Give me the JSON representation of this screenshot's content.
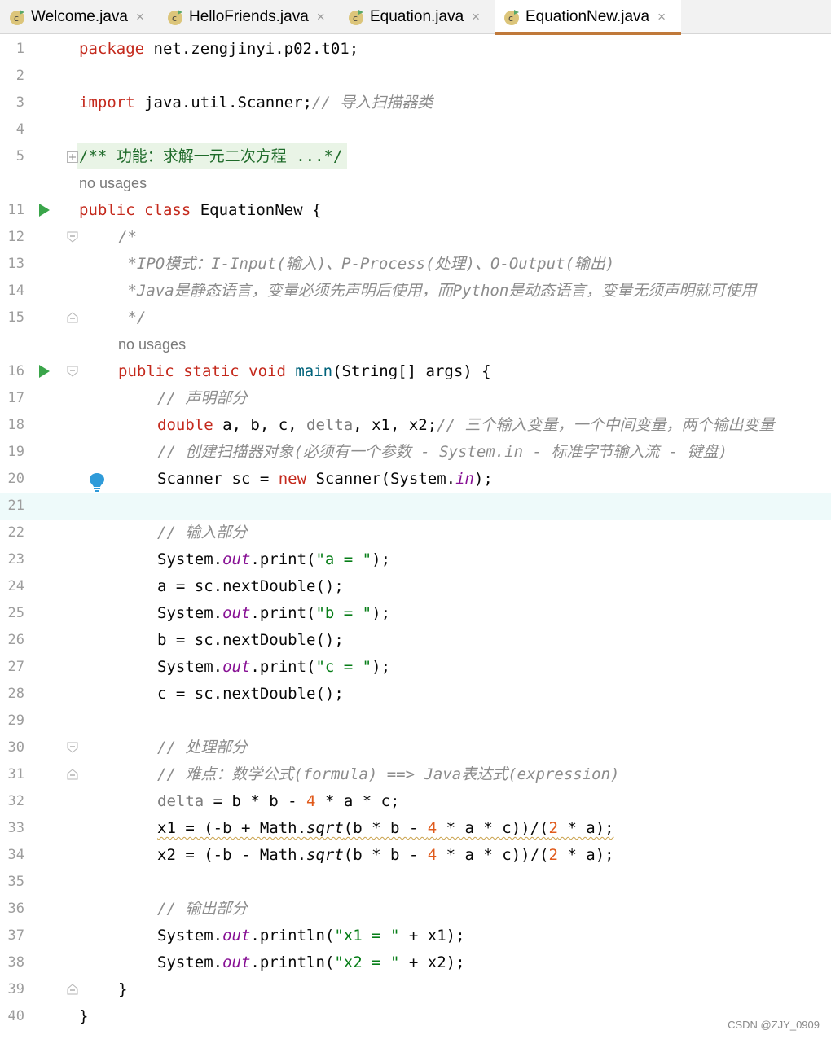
{
  "tabs": [
    {
      "label": "Welcome.java",
      "active": false
    },
    {
      "label": "HelloFriends.java",
      "active": false
    },
    {
      "label": "Equation.java",
      "active": false
    },
    {
      "label": "EquationNew.java",
      "active": true
    }
  ],
  "tab_close_glyph": "×",
  "gutter": {
    "line_numbers": [
      "1",
      "2",
      "3",
      "4",
      "5",
      "11",
      "12",
      "13",
      "14",
      "15",
      "16",
      "17",
      "18",
      "19",
      "20",
      "21",
      "22",
      "23",
      "24",
      "25",
      "26",
      "27",
      "28",
      "29",
      "30",
      "31",
      "32",
      "33",
      "34",
      "35",
      "36",
      "37",
      "38",
      "39",
      "40"
    ],
    "run_markers_on_lines": [
      "11",
      "16"
    ],
    "bulb_on_line": "20",
    "current_line": "21"
  },
  "hints": {
    "class_usages": "no usages",
    "main_usages": "no usages"
  },
  "code": {
    "l1_kw": "package",
    "l1_rest": " net.zengjinyi.p02.t01;",
    "l3_kw": "import",
    "l3_rest": " java.util.Scanner;",
    "l3_comment": "// 导入扫描器类",
    "l5": "/** 功能：求解一元二次方程 ...*/",
    "l11_kw": "public class",
    "l11_rest": " EquationNew {",
    "l12": "/*",
    "l13": " *IPO模式：I-Input(输入)、P-Process(处理)、O-Output(输出)",
    "l14": " *Java是静态语言，变量必须先声明后使用，而Python是动态语言，变量无须声明就可使用",
    "l15": " */",
    "l16_kw": "public static void",
    "l16_fn": " main",
    "l16_rest": "(String[] args) {",
    "l17": "// 声明部分",
    "l18_kw": "double",
    "l18_a": " a, b, c, ",
    "l18_delta": "delta",
    "l18_rest": ", x1, x2;",
    "l18_comment": "// 三个输入变量，一个中间变量，两个输出变量",
    "l19": "// 创建扫描器对象(必须有一个参数 - System.in - 标准字节输入流 - 键盘)",
    "l20_a": "Scanner sc = ",
    "l20_kw": "new",
    "l20_b": " Scanner(System.",
    "l20_in": "in",
    "l20_c": ");",
    "l22": "// 输入部分",
    "sys": "System.",
    "out": "out",
    "print": ".print(",
    "println": ".println(",
    "l23_str": "\"a = \"",
    "l25_str": "\"b = \"",
    "l27_str": "\"c = \"",
    "close": ");",
    "l24": "a = sc.nextDouble();",
    "l26": "b = sc.nextDouble();",
    "l28": "c = sc.nextDouble();",
    "l30": "// 处理部分",
    "l31": "// 难点：数学公式(formula) ==> Java表达式(expression)",
    "l32_delta": "delta",
    "l32_a": " = b * b - ",
    "l32_4": "4",
    "l32_b": " * a * c;",
    "l33_a": "x1 = (-b + Math.",
    "l34_a": "x2 = (-b - Math.",
    "sqrt": "sqrt",
    "l33_b": "(b * b - ",
    "l33_4": "4",
    "l33_c": " * a * c))/(",
    "l33_2": "2",
    "l33_d": " * a);",
    "l36": "// 输出部分",
    "l37_str": "\"x1 = \"",
    "l37_rest": " + x1);",
    "l38_str": "\"x2 = \"",
    "l38_rest": " + x2);",
    "l39": "}",
    "l40": "}"
  },
  "colors": {
    "keyword": "#0033b3",
    "comment": "#8c8c8c",
    "string": "#067d17",
    "number": "#e05a1b",
    "static_field": "#871094",
    "tab_accent": "#c0793a"
  },
  "watermark": "CSDN @ZJY_0909"
}
